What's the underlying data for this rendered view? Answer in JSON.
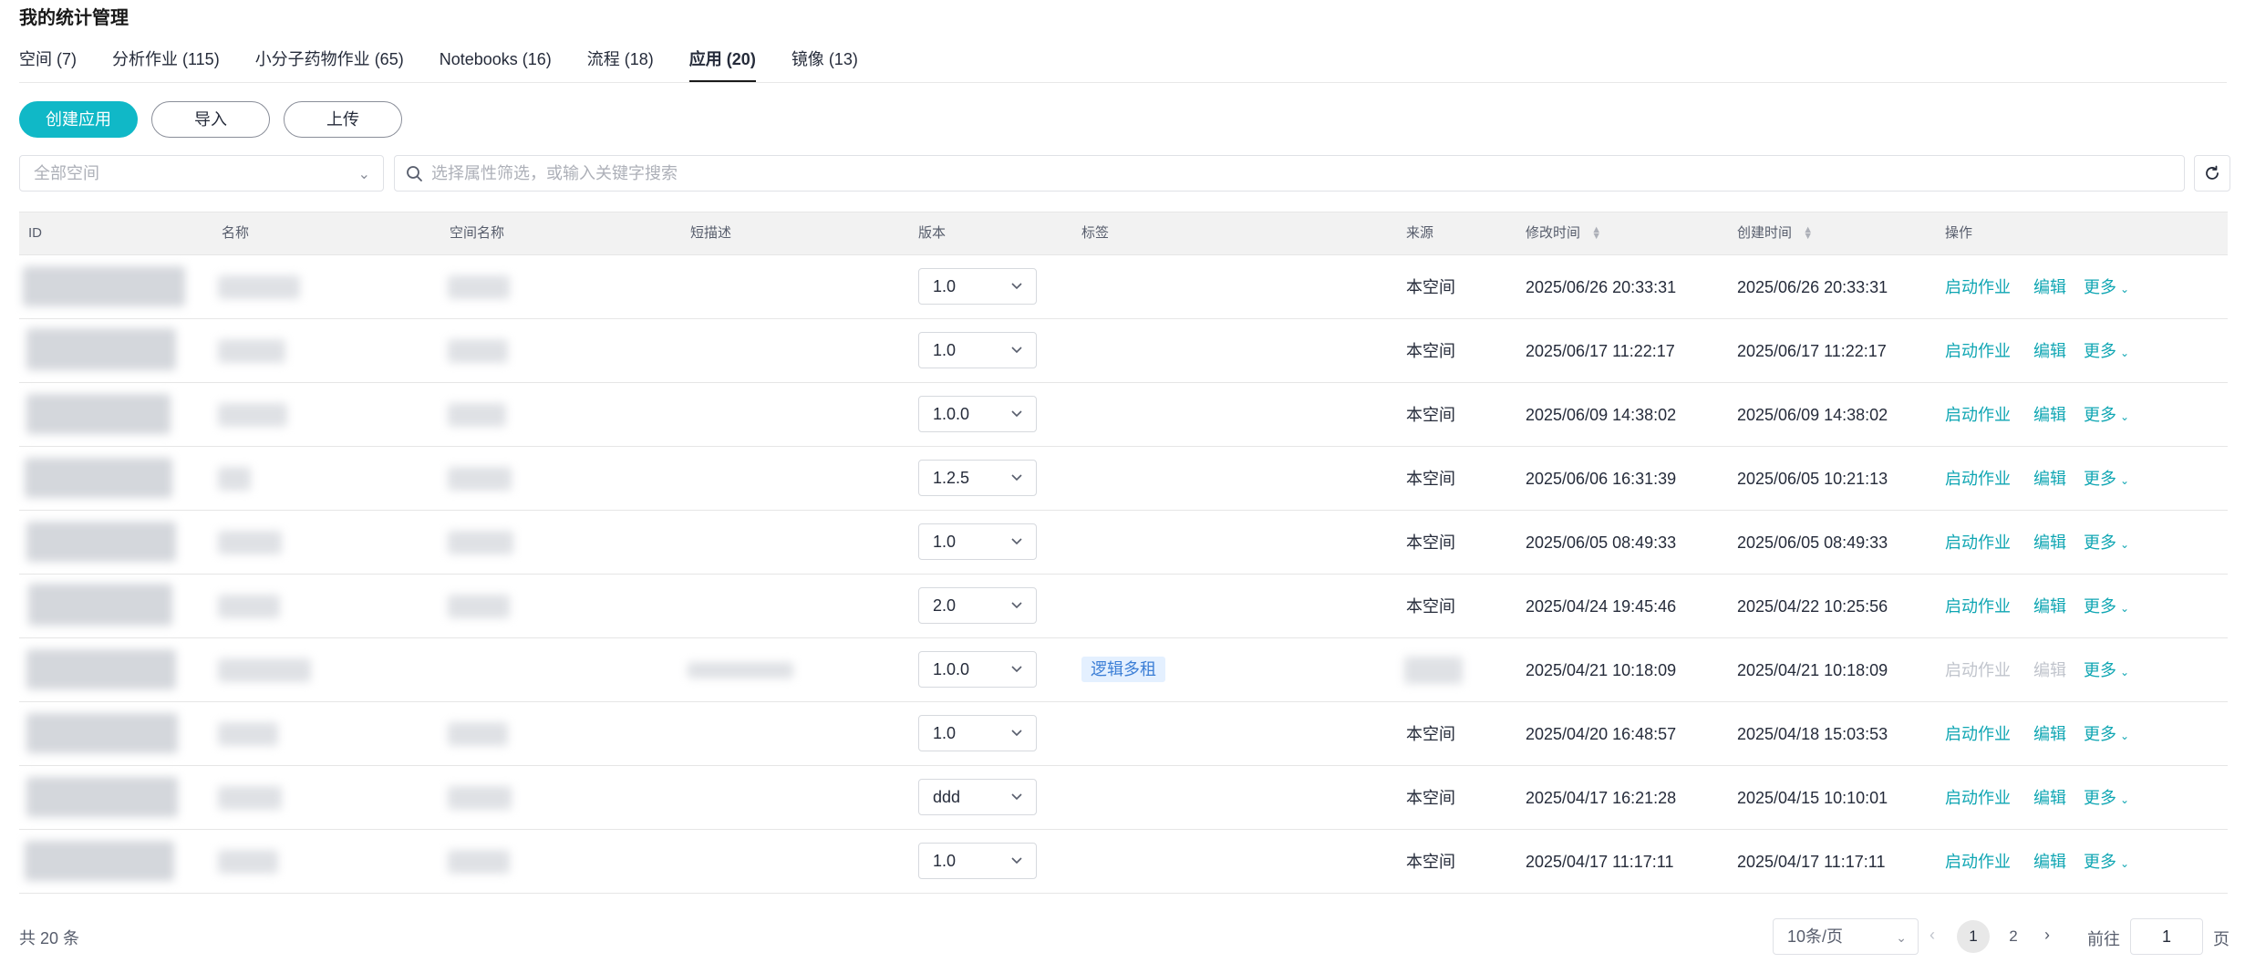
{
  "page_title": "我的统计管理",
  "tabs": [
    {
      "label": "空间 (7)",
      "active": false
    },
    {
      "label": "分析作业 (115)",
      "active": false
    },
    {
      "label": "小分子药物作业 (65)",
      "active": false
    },
    {
      "label": "Notebooks (16)",
      "active": false
    },
    {
      "label": "流程 (18)",
      "active": false
    },
    {
      "label": "应用 (20)",
      "active": true
    },
    {
      "label": "镜像 (13)",
      "active": false
    }
  ],
  "toolbar": {
    "create_label": "创建应用",
    "import_label": "导入",
    "upload_label": "上传"
  },
  "filters": {
    "space_placeholder": "全部空间",
    "search_placeholder": "选择属性筛选，或输入关键字搜索"
  },
  "table": {
    "columns": {
      "id": "ID",
      "name": "名称",
      "space": "空间名称",
      "desc": "短描述",
      "version": "版本",
      "tags": "标签",
      "source": "来源",
      "modified": "修改时间",
      "created": "创建时间",
      "ops": "操作"
    },
    "rows": [
      {
        "version": "1.0",
        "tag": "",
        "source": "本空间",
        "modified": "2025/06/26 20:33:31",
        "created": "2025/06/26 20:33:31",
        "ops_disabled": false
      },
      {
        "version": "1.0",
        "tag": "",
        "source": "本空间",
        "modified": "2025/06/17 11:22:17",
        "created": "2025/06/17 11:22:17",
        "ops_disabled": false
      },
      {
        "version": "1.0.0",
        "tag": "",
        "source": "本空间",
        "modified": "2025/06/09 14:38:02",
        "created": "2025/06/09 14:38:02",
        "ops_disabled": false
      },
      {
        "version": "1.2.5",
        "tag": "",
        "source": "本空间",
        "modified": "2025/06/06 16:31:39",
        "created": "2025/06/05 10:21:13",
        "ops_disabled": false
      },
      {
        "version": "1.0",
        "tag": "",
        "source": "本空间",
        "modified": "2025/06/05 08:49:33",
        "created": "2025/06/05 08:49:33",
        "ops_disabled": false
      },
      {
        "version": "2.0",
        "tag": "",
        "source": "本空间",
        "modified": "2025/04/24 19:45:46",
        "created": "2025/04/22 10:25:56",
        "ops_disabled": false
      },
      {
        "version": "1.0.0",
        "tag": "逻辑多租",
        "source": "",
        "modified": "2025/04/21 10:18:09",
        "created": "2025/04/21 10:18:09",
        "ops_disabled": true
      },
      {
        "version": "1.0",
        "tag": "",
        "source": "本空间",
        "modified": "2025/04/20 16:48:57",
        "created": "2025/04/18 15:03:53",
        "ops_disabled": false
      },
      {
        "version": "ddd",
        "tag": "",
        "source": "本空间",
        "modified": "2025/04/17 16:21:28",
        "created": "2025/04/15 10:10:01",
        "ops_disabled": false
      },
      {
        "version": "1.0",
        "tag": "",
        "source": "本空间",
        "modified": "2025/04/17 11:17:11",
        "created": "2025/04/17 11:17:11",
        "ops_disabled": false
      }
    ],
    "op_labels": {
      "start": "启动作业",
      "edit": "编辑",
      "more": "更多"
    }
  },
  "pagination": {
    "total_text": "共 20 条",
    "page_size": "10条/页",
    "pages": [
      "1",
      "2"
    ],
    "current_page": 1,
    "goto_label": "前往",
    "goto_value": "1",
    "page_label": "页"
  },
  "colors": {
    "primary": "#10b8c7",
    "link": "#10a6b3",
    "tag_bg": "#e4f0ff",
    "tag_text": "#3c7fd6"
  }
}
